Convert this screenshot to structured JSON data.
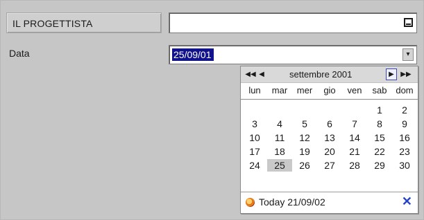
{
  "form": {
    "title_label": "IL PROGETTISTA",
    "title_value": "",
    "date_label": "Data",
    "date_value": "25/09/01"
  },
  "calendar": {
    "month_title": "settembre 2001",
    "weekdays": [
      "lun",
      "mar",
      "mer",
      "gio",
      "ven",
      "sab",
      "dom"
    ],
    "weeks": [
      [
        "",
        "",
        "",
        "",
        "",
        "1",
        "2"
      ],
      [
        "3",
        "4",
        "5",
        "6",
        "7",
        "8",
        "9"
      ],
      [
        "10",
        "11",
        "12",
        "13",
        "14",
        "15",
        "16"
      ],
      [
        "17",
        "18",
        "19",
        "20",
        "21",
        "22",
        "23"
      ],
      [
        "24",
        "25",
        "26",
        "27",
        "28",
        "29",
        "30"
      ]
    ],
    "selected_day": "25",
    "today_label": "Today 21/09/02",
    "icons": {
      "prev_year": "double-left-arrow-icon",
      "prev_month": "left-arrow-icon",
      "next_month": "right-arrow-icon",
      "next_year": "double-right-arrow-icon",
      "today": "today-circle-icon",
      "close": "close-icon"
    }
  },
  "colors": {
    "selection_bg": "#11138c",
    "selected_day_bg": "#c9c9c9",
    "close_icon": "#2443c8"
  }
}
